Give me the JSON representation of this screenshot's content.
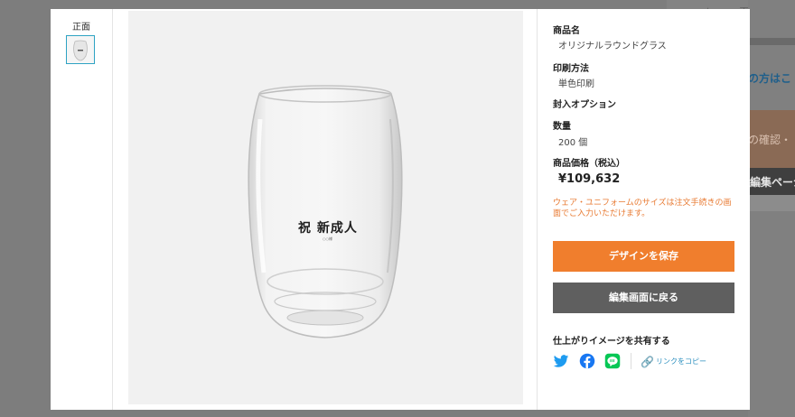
{
  "background": {
    "right_text_1": "の方はこ",
    "right_text_2": "の確認・",
    "right_text_3": "編集ページ"
  },
  "thumbnails": {
    "label": "正面"
  },
  "preview": {
    "glass_text": "祝 新成人",
    "glass_subtext": "○○様"
  },
  "product": {
    "name_label": "商品名",
    "name_value": "オリジナルラウンドグラス",
    "print_label": "印刷方法",
    "print_value": "単色印刷",
    "option_label": "封入オプション",
    "qty_label": "数量",
    "qty_value": "200 個",
    "price_label": "商品価格（税込）",
    "price_value": "¥109,632",
    "note": "ウェア・ユニフォームのサイズは注文手続きの画面でご入力いただけます。"
  },
  "buttons": {
    "save": "デザインを保存",
    "back": "編集画面に戻る"
  },
  "share": {
    "label": "仕上がりイメージを共有する",
    "copy_link": "リンクをコピー"
  },
  "colors": {
    "accent_orange": "#f07e2d",
    "back_button": "#5f5f5f",
    "twitter": "#1d9bf0",
    "facebook": "#1877f2",
    "line": "#06c755",
    "selected_border": "#2ea3c3"
  }
}
